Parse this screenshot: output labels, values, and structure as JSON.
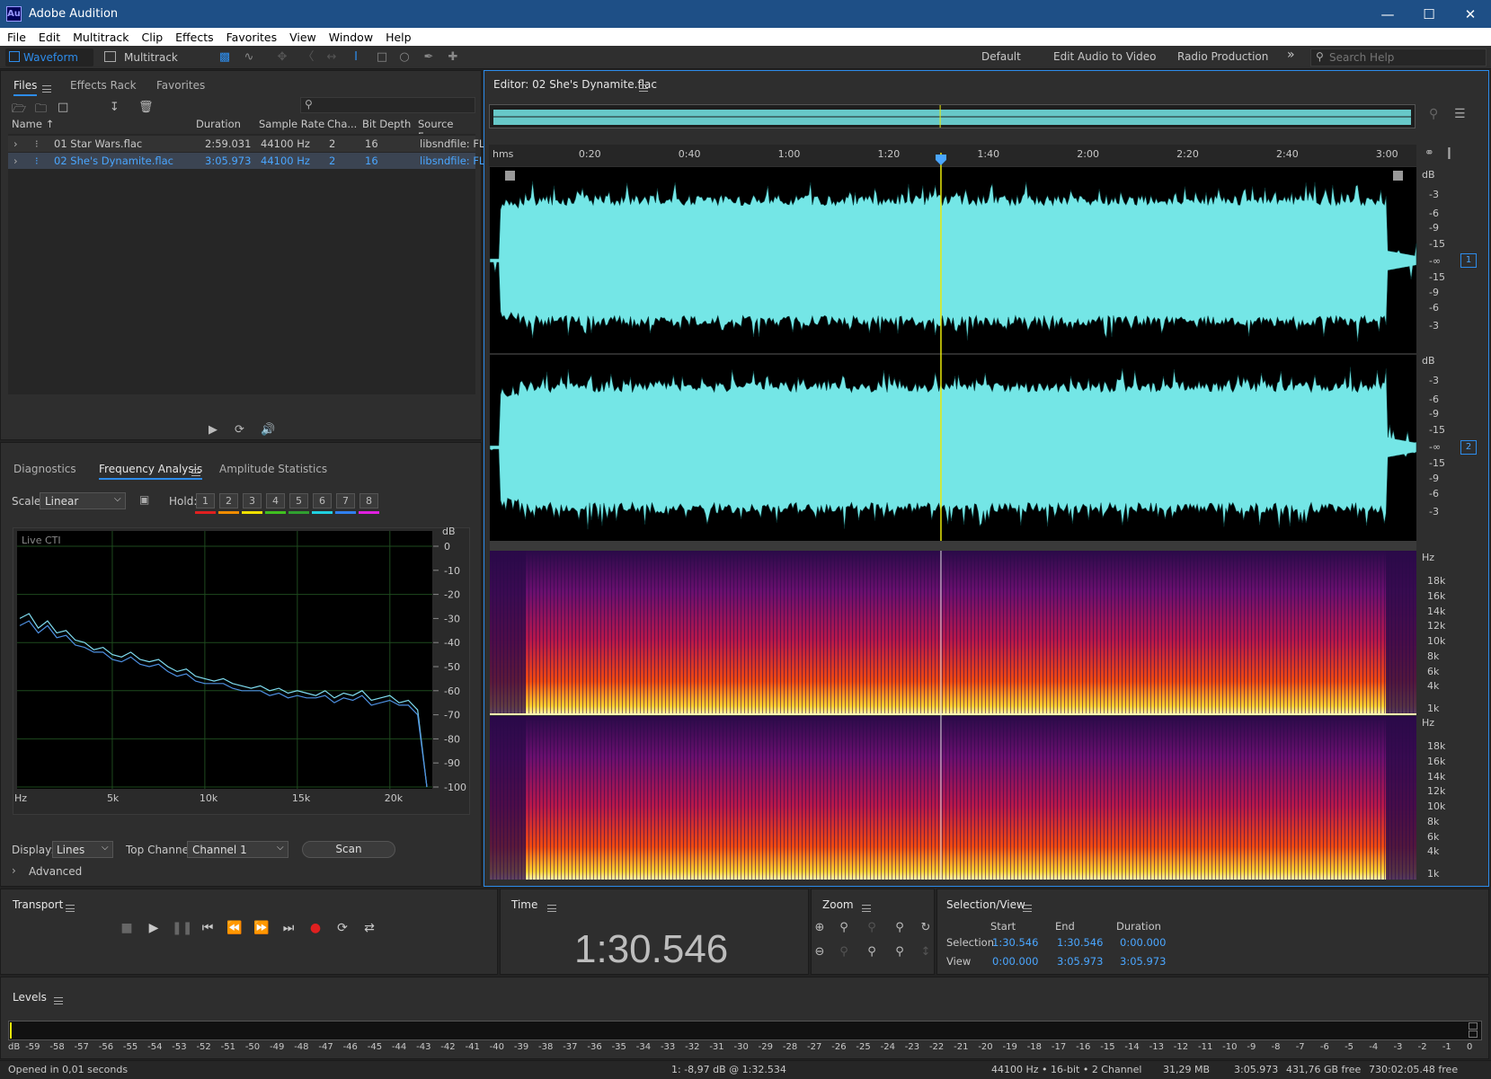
{
  "window": {
    "app_logo": "Au",
    "title": "Adobe Audition",
    "min_icon": "minimize-icon",
    "max_icon": "maximize-icon",
    "close_icon": "close-icon"
  },
  "menu": [
    "File",
    "Edit",
    "Multitrack",
    "Clip",
    "Effects",
    "Favorites",
    "View",
    "Window",
    "Help"
  ],
  "toolbar": {
    "waveform_label": "Waveform",
    "multitrack_label": "Multitrack"
  },
  "workspaces": {
    "default": "Default",
    "edit_audio_video": "Edit Audio to Video",
    "radio_production": "Radio Production",
    "more": "»",
    "search_placeholder": "Search Help"
  },
  "files_panel": {
    "tabs": [
      "Files",
      "Effects Rack",
      "Favorites"
    ],
    "columns": {
      "name": "Name ↑",
      "duration": "Duration",
      "sample_rate": "Sample Rate",
      "channels": "Cha...",
      "bit_depth": "Bit Depth",
      "source_format": "Source Form"
    },
    "rows": [
      {
        "name": "01 Star Wars.flac",
        "duration": "2:59.031",
        "sample_rate": "44100 Hz",
        "channels": "2",
        "bit_depth": "16",
        "source_format": "libsndfile: FL"
      },
      {
        "name": "02 She's Dynamite.flac",
        "duration": "3:05.973",
        "sample_rate": "44100 Hz",
        "channels": "2",
        "bit_depth": "16",
        "source_format": "libsndfile: FL"
      }
    ]
  },
  "analysis_panel": {
    "tabs": [
      "Diagnostics",
      "Frequency Analysis",
      "Amplitude Statistics"
    ],
    "scale_label": "Scale:",
    "scale_value": "Linear",
    "hold_label": "Hold:",
    "hold_buttons": [
      "1",
      "2",
      "3",
      "4",
      "5",
      "6",
      "7",
      "8"
    ],
    "hold_colors": [
      "#e02020",
      "#f08c00",
      "#f0e000",
      "#40c020",
      "#30a030",
      "#20d0e0",
      "#3080f0",
      "#e020e0"
    ],
    "live_label": "Live CTI",
    "y_unit": "dB",
    "y_ticks": [
      "0",
      "-10",
      "-20",
      "-30",
      "-40",
      "-50",
      "-60",
      "-70",
      "-80",
      "-90",
      "-100"
    ],
    "x_ticks": [
      "Hz",
      "5k",
      "10k",
      "15k",
      "20k"
    ],
    "display_label": "Display:",
    "display_value": "Lines",
    "top_channel_label": "Top Channel:",
    "top_channel_value": "Channel 1",
    "scan_label": "Scan",
    "advanced_label": "Advanced"
  },
  "chart_data": {
    "type": "line",
    "title": "",
    "xlabel": "Hz",
    "ylabel": "dB",
    "xlim": [
      0,
      22050
    ],
    "ylim": [
      -100,
      0
    ],
    "x": [
      0,
      500,
      1000,
      1500,
      2000,
      2500,
      3000,
      3500,
      4000,
      4500,
      5000,
      5500,
      6000,
      6500,
      7000,
      7500,
      8000,
      8500,
      9000,
      9500,
      10000,
      10500,
      11000,
      11500,
      12000,
      12500,
      13000,
      13500,
      14000,
      14500,
      15000,
      15500,
      16000,
      16500,
      17000,
      17500,
      18000,
      18500,
      19000,
      19500,
      20000,
      20500,
      21000,
      21500,
      22000
    ],
    "series": [
      {
        "values": [
          -30,
          -28,
          -34,
          -31,
          -36,
          -35,
          -39,
          -40,
          -43,
          -42,
          -45,
          -46,
          -44,
          -47,
          -48,
          -47,
          -50,
          -52,
          -51,
          -54,
          -55,
          -56,
          -55,
          -57,
          -58,
          -59,
          -58,
          -60,
          -59,
          -61,
          -60,
          -61,
          -62,
          -60,
          -63,
          -61,
          -62,
          -60,
          -64,
          -63,
          -62,
          -65,
          -64,
          -68,
          -100
        ]
      },
      {
        "values": [
          -33,
          -31,
          -36,
          -33,
          -38,
          -37,
          -41,
          -42,
          -44,
          -44,
          -47,
          -48,
          -46,
          -49,
          -50,
          -49,
          -52,
          -54,
          -53,
          -56,
          -57,
          -57,
          -57,
          -59,
          -60,
          -60,
          -60,
          -62,
          -61,
          -63,
          -62,
          -63,
          -63,
          -62,
          -65,
          -63,
          -64,
          -62,
          -66,
          -65,
          -64,
          -66,
          -66,
          -70,
          -100
        ]
      }
    ]
  },
  "editor": {
    "title": "Editor: 02 She's Dynamite.flac",
    "ruler_unit": "hms",
    "ruler_ticks": [
      "0:20",
      "0:40",
      "1:00",
      "1:20",
      "1:40",
      "2:00",
      "2:20",
      "2:40",
      "3:00"
    ],
    "db_ticks": [
      "dB",
      "-3",
      "-6",
      "-9",
      "-15",
      "-∞",
      "-15",
      "-9",
      "-6",
      "-3"
    ],
    "hz_ticks": [
      "Hz",
      "18k",
      "16k",
      "14k",
      "12k",
      "10k",
      "8k",
      "6k",
      "4k",
      "1k"
    ],
    "channel_1": "1",
    "channel_2": "2",
    "playhead_seconds": 90.546,
    "duration_seconds": 185.973
  },
  "transport": {
    "title": "Transport"
  },
  "time_panel": {
    "title": "Time",
    "value": "1:30.546"
  },
  "zoom_panel": {
    "title": "Zoom"
  },
  "selection_panel": {
    "title": "Selection/View",
    "start": "Start",
    "end": "End",
    "duration": "Duration",
    "selection_label": "Selection",
    "view_label": "View",
    "selection_start": "1:30.546",
    "selection_end": "1:30.546",
    "selection_duration": "0:00.000",
    "view_start": "0:00.000",
    "view_end": "3:05.973",
    "view_duration": "3:05.973"
  },
  "levels": {
    "title": "Levels",
    "ticks": [
      "dB",
      "-59",
      "-58",
      "-57",
      "-56",
      "-55",
      "-54",
      "-53",
      "-52",
      "-51",
      "-50",
      "-49",
      "-48",
      "-47",
      "-46",
      "-45",
      "-44",
      "-43",
      "-42",
      "-41",
      "-40",
      "-39",
      "-38",
      "-37",
      "-36",
      "-35",
      "-34",
      "-33",
      "-32",
      "-31",
      "-30",
      "-29",
      "-28",
      "-27",
      "-26",
      "-25",
      "-24",
      "-23",
      "-22",
      "-21",
      "-20",
      "-19",
      "-18",
      "-17",
      "-16",
      "-15",
      "-14",
      "-13",
      "-12",
      "-11",
      "-10",
      "-9",
      "-8",
      "-7",
      "-6",
      "-5",
      "-4",
      "-3",
      "-2",
      "-1",
      "0"
    ]
  },
  "status": {
    "opened": "Opened in 0,01 seconds",
    "cursor": "1: -8,97 dB @ 1:32.534",
    "format": "44100 Hz • 16-bit • 2 Channel",
    "size": "31,29 MB",
    "duration": "3:05.973",
    "free": "431,76 GB free",
    "free_time": "730:02:05.48 free"
  }
}
